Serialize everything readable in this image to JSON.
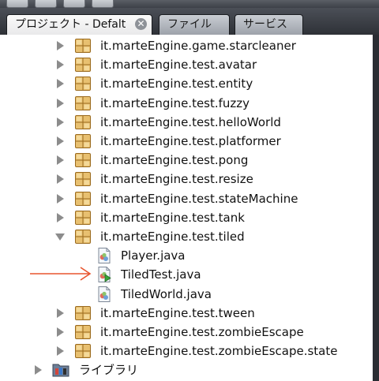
{
  "tabs": [
    {
      "label": "プロジェクト - Defalt",
      "active": true
    },
    {
      "label": "ファイル",
      "active": false
    },
    {
      "label": "サービス",
      "active": false
    }
  ],
  "tree": {
    "packages_before": [
      "it.marteEngine.game.starcleaner",
      "it.marteEngine.test.avatar",
      "it.marteEngine.test.entity",
      "it.marteEngine.test.fuzzy",
      "it.marteEngine.test.helloWorld",
      "it.marteEngine.test.platformer",
      "it.marteEngine.test.pong",
      "it.marteEngine.test.resize",
      "it.marteEngine.test.stateMachine",
      "it.marteEngine.test.tank"
    ],
    "expanded_package": "it.marteEngine.test.tiled",
    "files": [
      "Player.java",
      "TiledTest.java",
      "TiledWorld.java"
    ],
    "packages_after": [
      "it.marteEngine.test.tween",
      "it.marteEngine.test.zombieEscape",
      "it.marteEngine.test.zombieEscape.state"
    ],
    "library_label": "ライブラリ"
  },
  "colors": {
    "annotation_arrow": "#e8552e",
    "package_icon": "#e8c070"
  },
  "icons": {
    "package": "package-icon",
    "java_file": "java-file-icon",
    "library": "library-icon",
    "collapsed": "caret-right-icon",
    "expanded": "caret-down-icon"
  }
}
